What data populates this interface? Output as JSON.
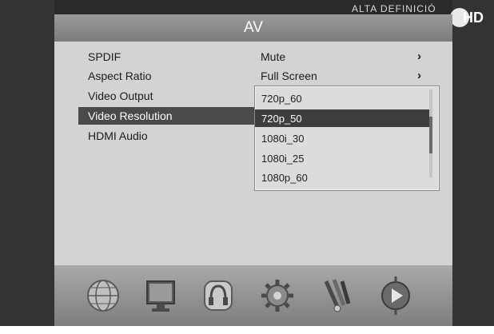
{
  "header": {
    "title": "AV",
    "top_caption": "ALTA DEFINICIÓ",
    "hd_label": "HD"
  },
  "menu": {
    "items": [
      {
        "label": "SPDIF",
        "value": "Mute",
        "arrow": "›"
      },
      {
        "label": "Aspect Ratio",
        "value": "Full Screen",
        "arrow": "›"
      },
      {
        "label": "Video Output",
        "value": "",
        "arrow": ""
      },
      {
        "label": "Video Resolution",
        "value": "",
        "arrow": ""
      },
      {
        "label": "HDMI Audio",
        "value": "",
        "arrow": ""
      }
    ],
    "selected_index": 3
  },
  "dropdown": {
    "options": [
      "720p_60",
      "720p_50",
      "1080i_30",
      "1080i_25",
      "1080p_60"
    ],
    "selected": "720p_50"
  },
  "icon_bar": {
    "icons": [
      "globe-icon",
      "monitor-icon",
      "headphones-icon",
      "gear-icon",
      "connector-icon",
      "play-icon"
    ]
  },
  "colors": {
    "panel": "#d3d3d3",
    "title_bar": "#8a8a8a",
    "highlight": "#4a4a4a",
    "background": "#3a3a3a"
  }
}
